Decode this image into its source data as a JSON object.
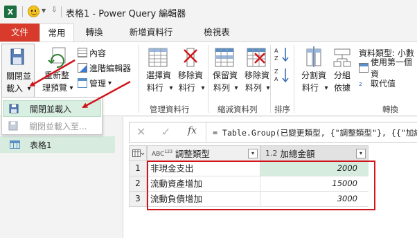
{
  "window": {
    "app_logo_letter": "X",
    "title": "表格1 - Power Query 編輯器"
  },
  "tabs": [
    {
      "label": "文件"
    },
    {
      "label": "常用"
    },
    {
      "label": "轉換"
    },
    {
      "label": "新增資料行"
    },
    {
      "label": "檢視表"
    }
  ],
  "ribbon": {
    "close_load": {
      "line1": "關閉並",
      "line2": "載入",
      "arrow": "▾"
    },
    "refresh_preview": {
      "line1": "重新整",
      "line2": "理預覽",
      "arrow": "▾"
    },
    "properties": "內容",
    "advanced_editor": "進階編輯器",
    "manage": "管理",
    "manage_arrow": "▾",
    "choose_columns": {
      "line1": "選擇資",
      "line2": "料行",
      "arrow": "▾"
    },
    "remove_columns": {
      "line1": "移除資",
      "line2": "料行",
      "arrow": "▾"
    },
    "keep_rows": {
      "line1": "保留資",
      "line2": "料列",
      "arrow": "▾"
    },
    "remove_rows": {
      "line1": "移除資",
      "line2": "料列",
      "arrow": "▾"
    },
    "split_column": {
      "line1": "分割資",
      "line2": "料行",
      "arrow": "▾"
    },
    "group_by": {
      "line1": "分組",
      "line2": "依據"
    },
    "data_type": "資料類型: 小數",
    "use_first_row": "使用第一個資",
    "replace_values": "取代值",
    "replace_values_prefix": "₂",
    "group_labels": {
      "manage_columns": "管理資料行",
      "reduce_rows": "縮減資料列",
      "sort": "排序",
      "transform": "轉換"
    }
  },
  "menu": {
    "items": [
      {
        "label": "關閉並載入",
        "enabled": true
      },
      {
        "label": "關閉並載入至...",
        "enabled": false
      }
    ]
  },
  "queries": {
    "items": [
      {
        "label": "表格1"
      }
    ]
  },
  "formula_bar": {
    "cancel": "✕",
    "confirm": "✓",
    "fx": "fx",
    "formula": "= Table.Group(已變更類型, {\"調整類型\"}, {{\"加總"
  },
  "table": {
    "columns": [
      {
        "type_icon": "ABC",
        "type_icon_sup": "123",
        "name": "調整類型",
        "dd": "▾"
      },
      {
        "type_icon": "1.2",
        "name": "加總金額",
        "dd": "▾"
      }
    ],
    "rows": [
      {
        "num": "1",
        "type": "非現金支出",
        "amount": "2000"
      },
      {
        "num": "2",
        "type": "流動資產增加",
        "amount": "15000"
      },
      {
        "num": "3",
        "type": "流動負債增加",
        "amount": "3000"
      }
    ]
  },
  "colors": {
    "file_tab": "#d83b2b",
    "excel_green": "#1d6f42",
    "highlight_green": "#d7ecdf",
    "annotation_red": "#d0161c"
  }
}
